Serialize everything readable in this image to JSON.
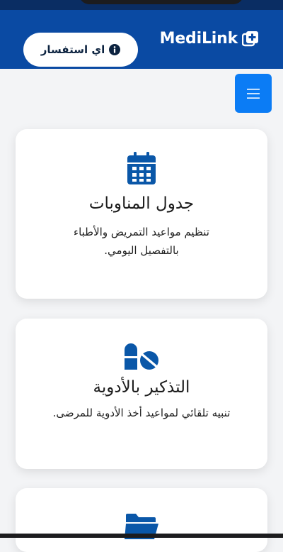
{
  "header": {
    "brand": "MediLink",
    "inquiry_label": "اي استفسار",
    "brand_color": "#0a4aa3",
    "accent_color": "#0b7cf5"
  },
  "menu": {
    "icon": "hamburger-icon"
  },
  "cards": [
    {
      "icon": "calendar-icon",
      "title": "جدول المناوبات",
      "description": "تنظيم مواعيد التمريض والأطباء بالتفصيل اليومي."
    },
    {
      "icon": "pills-icon",
      "title": "التذكير بالأدوية",
      "description": "تنبيه تلقائي لمواعيد أخذ الأدوية للمرضى."
    },
    {
      "icon": "folder-icon"
    }
  ]
}
